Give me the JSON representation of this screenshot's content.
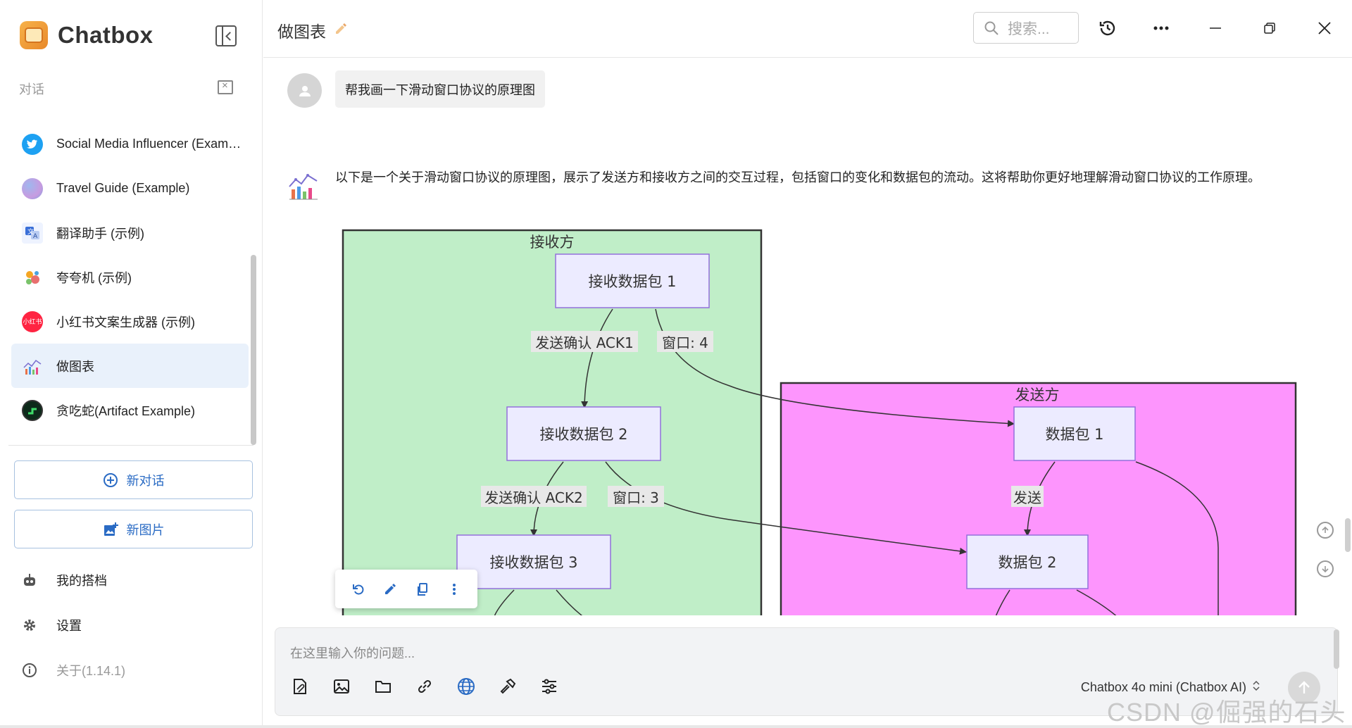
{
  "app": {
    "name": "Chatbox",
    "section_label": "对话"
  },
  "sidebar": {
    "conversations": [
      {
        "label": "Social Media Influencer (Example)",
        "icon": "twitter-icon",
        "active": false
      },
      {
        "label": "Travel Guide (Example)",
        "icon": "globe-icon",
        "active": false
      },
      {
        "label": "翻译助手 (示例)",
        "icon": "translate-icon",
        "active": false
      },
      {
        "label": "夸夸机 (示例)",
        "icon": "sparkle-icon",
        "active": false
      },
      {
        "label": "小红书文案生成器 (示例)",
        "icon": "xiaohongshu-icon",
        "active": false
      },
      {
        "label": "做图表",
        "icon": "chart-icon",
        "active": true
      },
      {
        "label": "贪吃蛇(Artifact Example)",
        "icon": "snake-game-icon",
        "active": false
      }
    ],
    "xhs_badge": "小红书",
    "new_chat_label": "新对话",
    "new_image_label": "新图片",
    "my_copilots_label": "我的搭档",
    "settings_label": "设置",
    "about_label": "关于(1.14.1)"
  },
  "header": {
    "title": "做图表",
    "search_placeholder": "搜索..."
  },
  "messages": {
    "user_text": "帮我画一下滑动窗口协议的原理图",
    "ai_text": "以下是一个关于滑动窗口协议的原理图，展示了发送方和接收方之间的交互过程，包括窗口的变化和数据包的流动。这将帮助你更好地理解滑动窗口协议的工作原理。"
  },
  "diagram": {
    "receiver_title": "接收方",
    "sender_title": "发送方",
    "recv1": "接收数据包 1",
    "recv2": "接收数据包 2",
    "recv3": "接收数据包 3",
    "pkt1": "数据包 1",
    "pkt2": "数据包 2",
    "ack1": "发送确认 ACK1",
    "win4": "窗口: 4",
    "ack2": "发送确认 ACK2",
    "win3": "窗口: 3",
    "send": "发送",
    "colors": {
      "receiver_bg": "#c0eec8",
      "sender_bg": "#fd95fd",
      "node_bg": "#ecebff",
      "node_border": "#9370db",
      "label_bg": "#e8e8e8"
    }
  },
  "input": {
    "placeholder": "在这里输入你的问题...",
    "model": "Chatbox 4o mini (Chatbox AI)"
  },
  "watermark": "CSDN @倔强的石头_"
}
